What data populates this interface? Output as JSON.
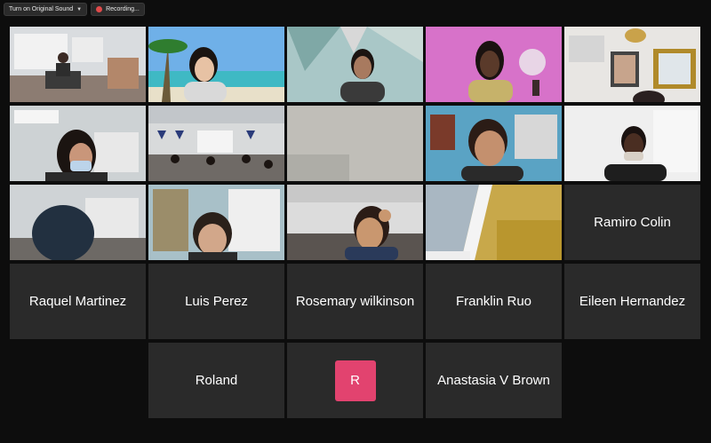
{
  "topbar": {
    "original_sound": "Turn on Original Sound",
    "recording": "Recording..."
  },
  "colors": {
    "active_border": "#e6e873",
    "avatar_r": "#e2436f",
    "tile_bg": "#2a2a2a",
    "page_bg": "#0d0d0d"
  },
  "name_tiles": {
    "ramiro": "Ramiro Colin",
    "raquel": "Raquel Martinez",
    "luis": "Luis Perez",
    "rosemary": "Rosemary wilkinson",
    "franklin": "Franklin Ruo",
    "eileen": "Eileen Hernandez",
    "roland": "Roland",
    "r_initial": "R",
    "anastasia": "Anastasia V Brown"
  }
}
